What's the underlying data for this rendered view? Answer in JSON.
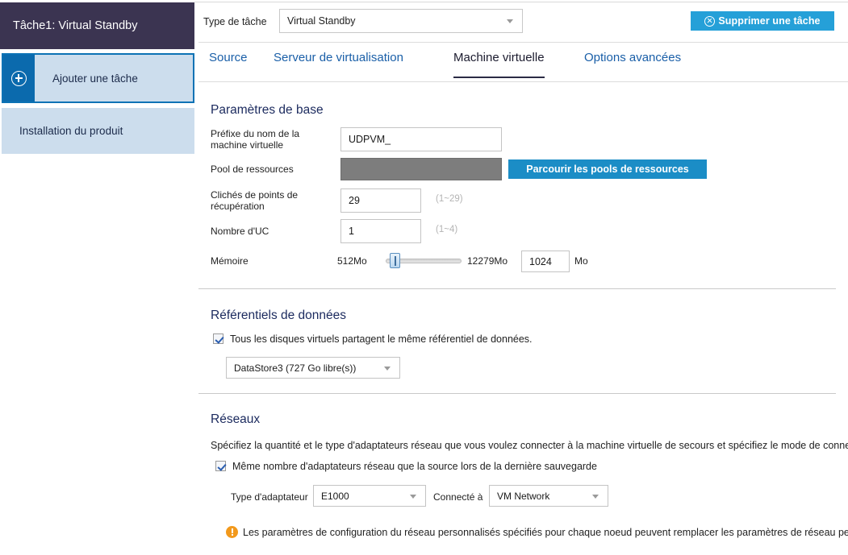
{
  "sidebar": {
    "task_header": "Tâche1: Virtual Standby",
    "add_task_label": "Ajouter une tâche",
    "add_task_icon": "plus-circle-icon",
    "install_label": "Installation du produit"
  },
  "header": {
    "task_type_label": "Type de tâche",
    "task_type_value": "Virtual Standby",
    "delete_task_label": "Supprimer une tâche",
    "delete_task_icon": "x-circle-icon"
  },
  "tabs": [
    {
      "label": "Source",
      "active": false
    },
    {
      "label": "Serveur de virtualisation",
      "active": false
    },
    {
      "label": "Machine virtuelle",
      "active": true
    },
    {
      "label": "Options avancées",
      "active": false
    }
  ],
  "basic_settings": {
    "title": "Paramètres de base",
    "vm_prefix_label": "Préfixe du nom de la machine virtuelle",
    "vm_prefix_value": "UDPVM_",
    "resource_pool_label": "Pool de ressources",
    "resource_pool_value": "",
    "browse_pools_label": "Parcourir les pools de ressources",
    "snapshots_label": "Clichés de points de récupération",
    "snapshots_value": "29",
    "snapshots_hint": "(1~29)",
    "cpu_label": "Nombre d'UC",
    "cpu_value": "1",
    "cpu_hint": "(1~4)",
    "memory_label": "Mémoire",
    "memory_min": "512Mo",
    "memory_max": "12279Mo",
    "memory_value": "1024",
    "memory_unit": "Mo"
  },
  "datastores": {
    "title": "Référentiels de données",
    "share_checkbox_label": "Tous les disques virtuels partagent le même référentiel de données.",
    "share_checked": true,
    "datastore_value": "DataStore3 (727 Go libre(s))"
  },
  "networks": {
    "title": "Réseaux",
    "description": "Spécifiez la quantité et le type d'adaptateurs réseau que vous voulez connecter à la machine virtuelle de secours et spécifiez le mode de connexion de",
    "same_count_label": "Même nombre d'adaptateurs réseau que la source lors de la dernière sauvegarde",
    "same_count_checked": true,
    "adapter_type_label": "Type d'adaptateur",
    "adapter_type_value": "E1000",
    "connected_to_label": "Connecté à",
    "connected_to_value": "VM Network",
    "warning_icon": "warning-exclamation-icon",
    "warning_text": "Les paramètres de configuration du réseau personnalisés spécifiés pour chaque noeud peuvent remplacer les paramètres de réseau personnalis"
  },
  "colors": {
    "header_purple": "#3b3451",
    "accent_blue": "#0b6aad",
    "button_blue": "#25a0d8",
    "sidebar_item": "#ccdded",
    "tab_link": "#1a5fa8",
    "warning_orange": "#f2991c"
  }
}
